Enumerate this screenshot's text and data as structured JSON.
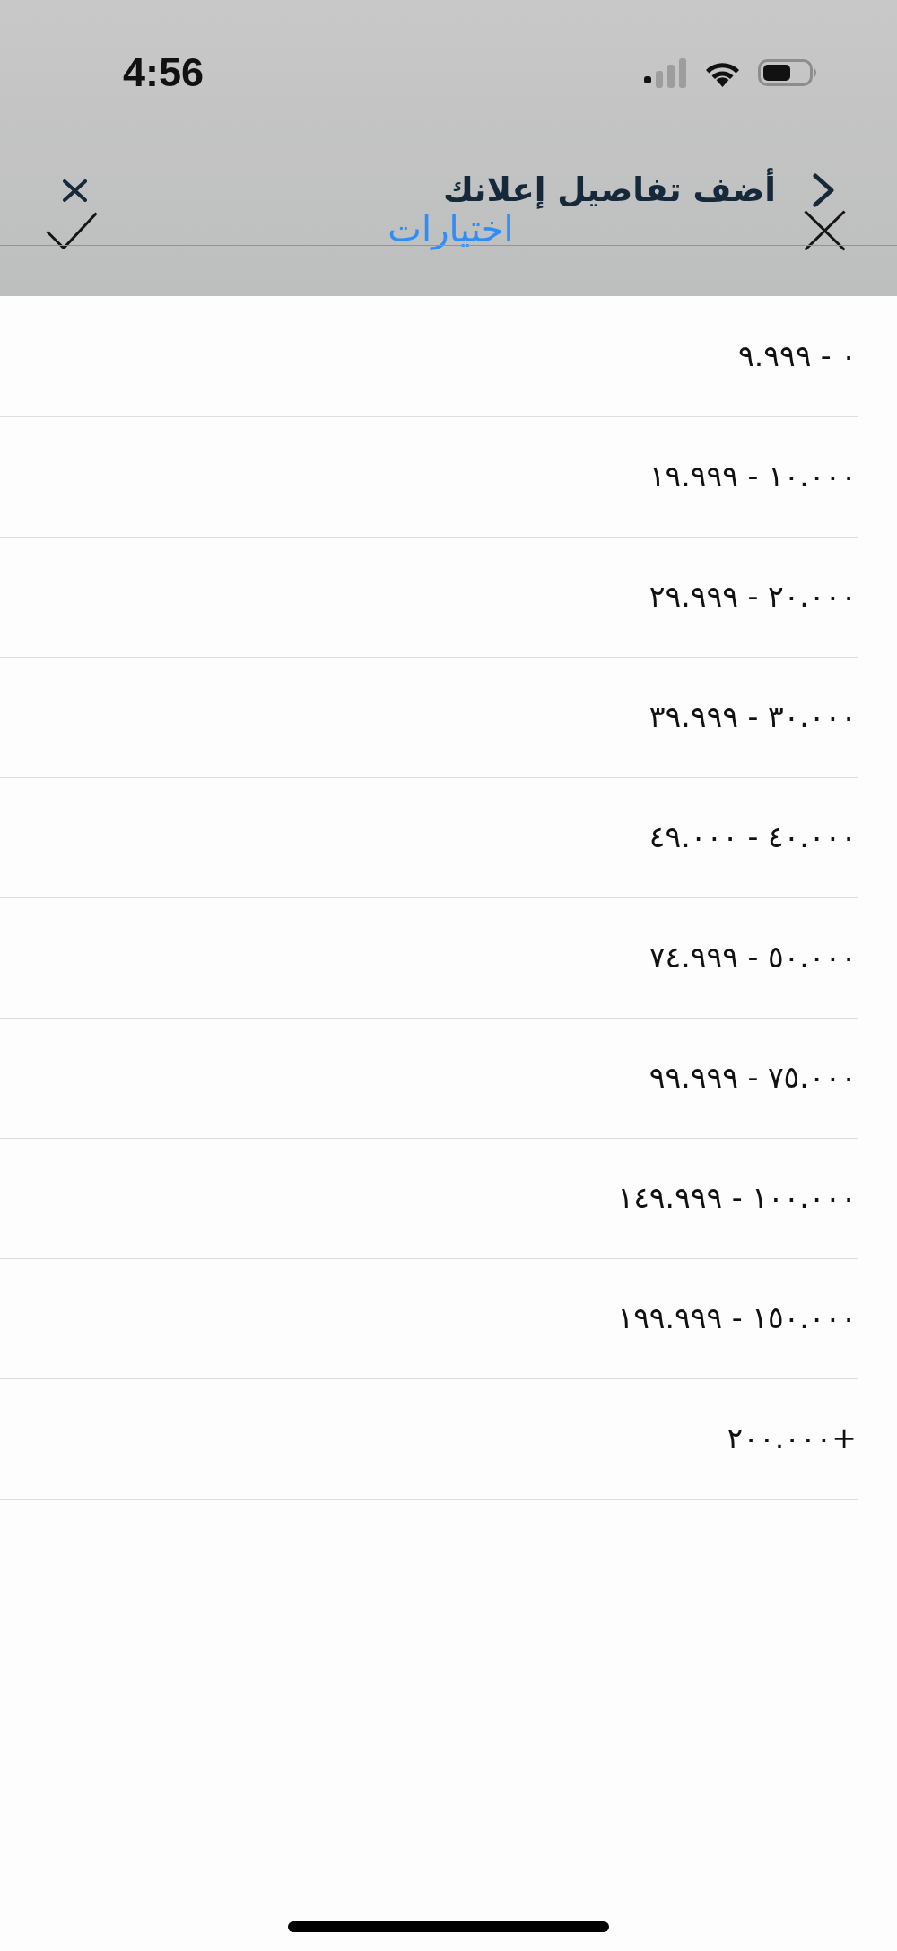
{
  "status_bar": {
    "time": "4:56"
  },
  "background_page": {
    "title": "أضف تفاصيل إعلانك"
  },
  "sheet": {
    "title": "اختيارات"
  },
  "options": [
    {
      "label": "٠ - ٩.٩٩٩",
      "selected": false
    },
    {
      "label": "١٠.٠٠٠ - ١٩.٩٩٩",
      "selected": false
    },
    {
      "label": "٢٠.٠٠٠ - ٢٩.٩٩٩",
      "selected": false
    },
    {
      "label": "٣٠.٠٠٠ - ٣٩.٩٩٩",
      "selected": false
    },
    {
      "label": "٤٠.٠٠٠ - ٤٩.٠٠٠",
      "selected": false
    },
    {
      "label": "٥٠.٠٠٠ - ٧٤.٩٩٩",
      "selected": false
    },
    {
      "label": "٧٥.٠٠٠ - ٩٩.٩٩٩",
      "selected": false
    },
    {
      "label": "١٠٠.٠٠٠ - ١٤٩.٩٩٩",
      "selected": false
    },
    {
      "label": "١٥٠.٠٠٠ - ١٩٩.٩٩٩",
      "selected": false
    },
    {
      "label": "+٢٠٠.٠٠٠",
      "selected": false
    }
  ]
}
